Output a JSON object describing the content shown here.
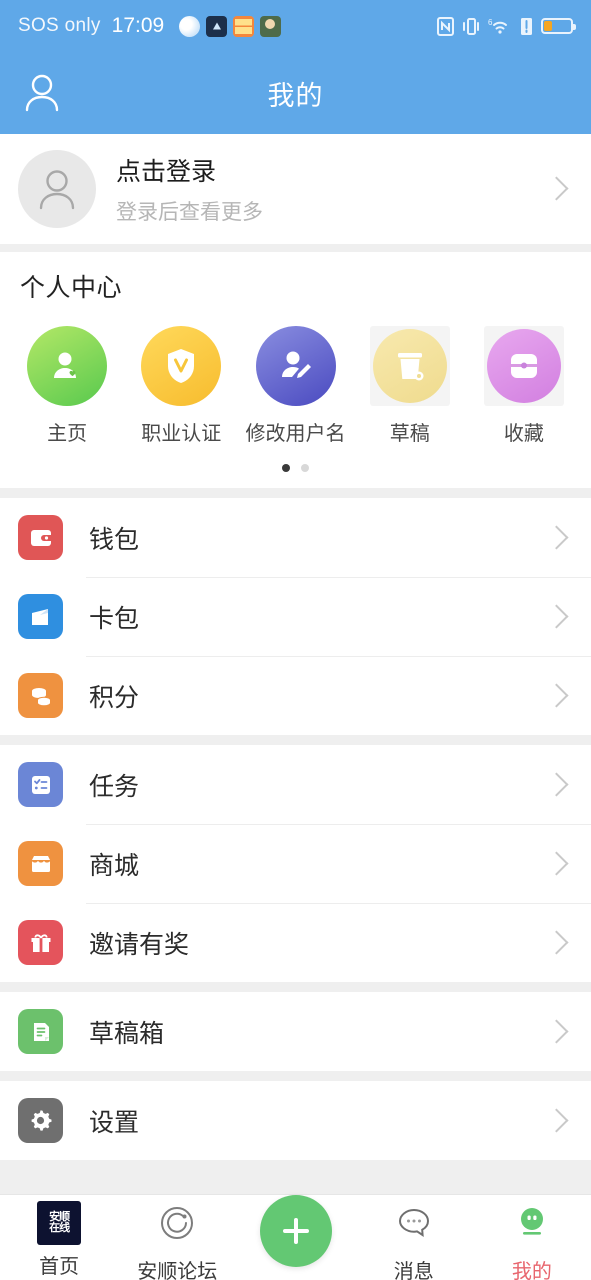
{
  "statusbar": {
    "carrier": "SOS only",
    "time": "17:09",
    "app_icons": [
      "weather-icon",
      "upload-arrow-icon",
      "orange-app-icon",
      "green-app-icon"
    ],
    "right_icons": [
      "nfc-icon",
      "vibrate-icon",
      "wifi-6-icon",
      "signal-alert-icon",
      "battery-icon"
    ],
    "battery_percent": 30
  },
  "header": {
    "title": "我的",
    "left_icon": "person-outline-icon"
  },
  "login": {
    "title": "点击登录",
    "subtitle": "登录后查看更多",
    "avatar_icon": "person-avatar-icon",
    "chevron_icon": "chevron-right-icon"
  },
  "personal_center": {
    "title": "个人中心",
    "items": [
      {
        "label": "主页",
        "icon": "home-user-icon",
        "color_start": "#b4e867",
        "color_end": "#58c94e",
        "placeholder": false
      },
      {
        "label": "职业认证",
        "icon": "shield-verify-icon",
        "color_start": "#ffd95b",
        "color_end": "#f7bc2e",
        "placeholder": false
      },
      {
        "label": "修改用户名",
        "icon": "edit-user-icon",
        "color_start": "#8a8ee0",
        "color_end": "#4f4fc4",
        "placeholder": false
      },
      {
        "label": "草稿",
        "icon": "trash-draft-icon",
        "color_start": "#f7e6a8",
        "color_end": "#f0dd92",
        "placeholder": true
      },
      {
        "label": "收藏",
        "icon": "collection-box-icon",
        "color_start": "#e6a3ea",
        "color_end": "#d58adf",
        "placeholder": true
      }
    ],
    "page_dots": {
      "count": 2,
      "active_index": 0
    }
  },
  "menu_groups": [
    {
      "items": [
        {
          "label": "钱包",
          "icon": "wallet-icon",
          "color": "#e05656"
        },
        {
          "label": "卡包",
          "icon": "card-pack-icon",
          "color": "#2f8fe0"
        },
        {
          "label": "积分",
          "icon": "coins-points-icon",
          "color": "#ef9240"
        }
      ]
    },
    {
      "items": [
        {
          "label": "任务",
          "icon": "task-list-icon",
          "color": "#6b86d6"
        },
        {
          "label": "商城",
          "icon": "shop-icon",
          "color": "#ef9240"
        },
        {
          "label": "邀请有奖",
          "icon": "gift-icon",
          "color": "#e4545c"
        }
      ]
    },
    {
      "items": [
        {
          "label": "草稿箱",
          "icon": "draft-box-icon",
          "color": "#6cc16c"
        }
      ]
    },
    {
      "items": [
        {
          "label": "设置",
          "icon": "gear-icon",
          "color": "#6f6f6f"
        }
      ]
    }
  ],
  "tabbar": {
    "items": [
      {
        "label": "首页",
        "icon": "anshun-logo-icon",
        "active": false
      },
      {
        "label": "安顺论坛",
        "icon": "forum-circle-icon",
        "active": false
      },
      {
        "label": "",
        "icon": "add-plus-icon",
        "active": false
      },
      {
        "label": "消息",
        "icon": "message-bubble-icon",
        "active": false
      },
      {
        "label": "我的",
        "icon": "profile-face-icon",
        "active": true
      }
    ],
    "logo_text_top": "安顺",
    "logo_text_bottom": "在线",
    "active_color": "#e8666e",
    "fab_color": "#63c873"
  }
}
